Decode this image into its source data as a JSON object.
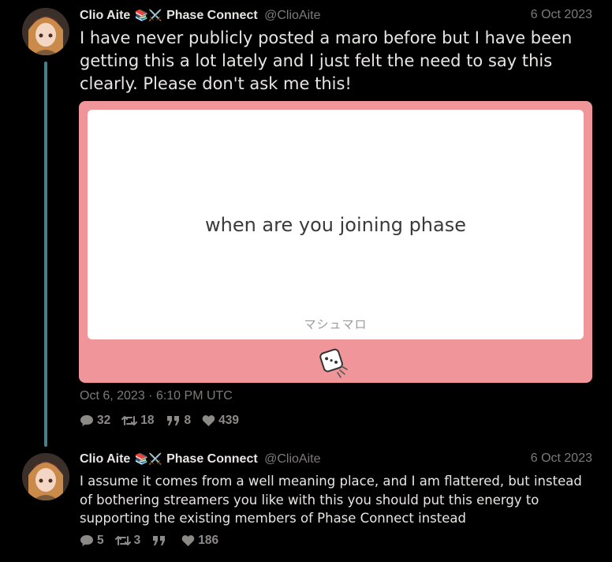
{
  "tweets": [
    {
      "author": {
        "name": "Clio Aite",
        "emoji": "📚⚔️",
        "org": "Phase Connect",
        "handle": "@ClioAite"
      },
      "date": "6 Oct 2023",
      "text": "I have never publicly posted a maro before but I have been getting this a lot lately and I just felt the need to say this clearly. Please don't ask me this!",
      "media": {
        "question": "when are you joining phase",
        "brand": "マシュマロ",
        "icon": "marshmallow-dice-icon"
      },
      "timestamp": "Oct 6, 2023 · 6:10 PM UTC",
      "stats": {
        "replies": "32",
        "retweets": "18",
        "quotes": "8",
        "likes": "439"
      }
    },
    {
      "author": {
        "name": "Clio Aite",
        "emoji": "📚⚔️",
        "org": "Phase Connect",
        "handle": "@ClioAite"
      },
      "date": "6 Oct 2023",
      "text": "I assume it comes from a well meaning place, and I am flattered, but instead of bothering streamers you like with this you should put this energy to supporting the existing members of Phase Connect instead",
      "stats": {
        "replies": "5",
        "retweets": "3",
        "quotes": "",
        "likes": "186"
      }
    }
  ],
  "colors": {
    "background": "#000000",
    "thread_line": "#4a7f88",
    "media_frame": "#f0969a",
    "muted": "#7d7b78"
  }
}
